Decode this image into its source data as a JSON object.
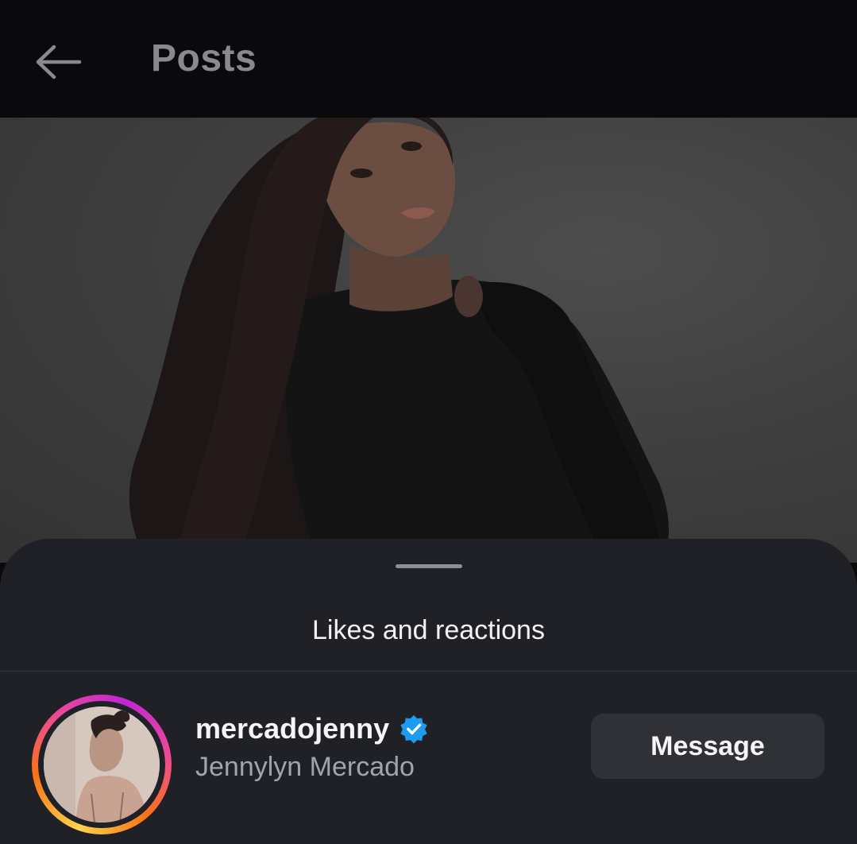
{
  "header": {
    "back_icon": "arrow-left-icon",
    "title": "Posts"
  },
  "post": {
    "image": "portrait-photo"
  },
  "sheet": {
    "title": "Likes and reactions",
    "users": [
      {
        "username": "mercadojenny",
        "full_name": "Jennylyn Mercado",
        "verified_icon": "verified-badge-icon",
        "action_label": "Message"
      }
    ]
  },
  "colors": {
    "background": "#0a0a0c",
    "sheet": "#202126",
    "verified": "#1d9bf0",
    "button": "#2f3137"
  }
}
